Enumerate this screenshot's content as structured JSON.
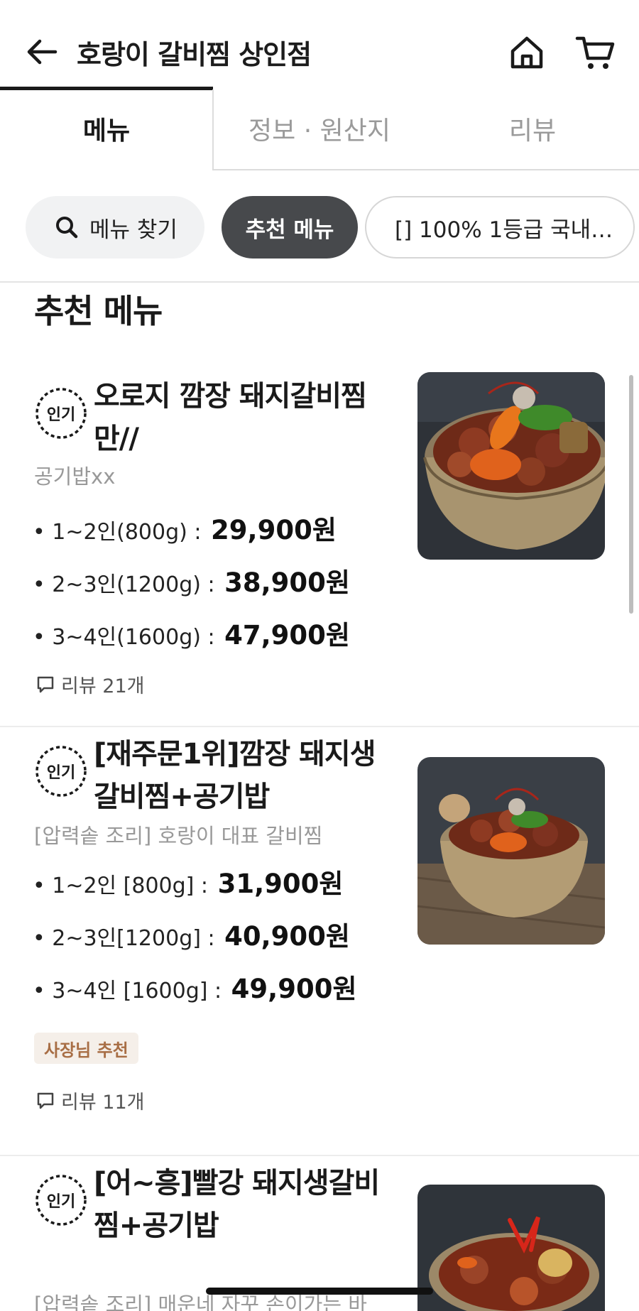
{
  "header": {
    "title": "호랑이 갈비찜 상인점",
    "icons": [
      "back-arrow-icon",
      "home-icon",
      "cart-icon"
    ]
  },
  "tabs": [
    {
      "label": "메뉴",
      "active": true
    },
    {
      "label": "정보 · 원산지",
      "active": false
    },
    {
      "label": "리뷰",
      "active": false
    }
  ],
  "chips": {
    "search": "메뉴 찾기",
    "recommend": "추천 메뉴",
    "origin": "[] 100% 1등급 국내…"
  },
  "section_title": "추천 메뉴",
  "items": [
    {
      "badge": "인기",
      "name_line1": "오로지 깜장 돼지갈비찜",
      "name_line2": "만//",
      "desc": "공기밥xx",
      "prices": [
        {
          "label": "• 1~2인(800g) :",
          "value": "29,900원"
        },
        {
          "label": "• 2~3인(1200g) :",
          "value": "38,900원"
        },
        {
          "label": "• 3~4인(1600g) :",
          "value": "47,900원"
        }
      ],
      "review": "리뷰 21개"
    },
    {
      "badge": "인기",
      "name_line1": "[재주문1위]깜장 돼지생",
      "name_line2": "갈비찜+공기밥",
      "desc": "[압력솥 조리]  호랑이 대표 갈비찜",
      "prices": [
        {
          "label": "• 1~2인 [800g] :",
          "value": "31,900원"
        },
        {
          "label": "• 2~3인[1200g] :",
          "value": "40,900원"
        },
        {
          "label": "• 3~4인 [1600g] :",
          "value": "49,900원"
        }
      ],
      "tag": "사장님 추천",
      "review": "리뷰 11개"
    },
    {
      "badge": "인기",
      "name_line1": "[어~흥]빨강 돼지생갈비",
      "name_line2": "찜+공기밥",
      "desc": "[압력솥 조리] 매운네 자꾸 손이가는 바"
    }
  ],
  "colors": {
    "active_chip": "#47494c",
    "owner_tag_bg": "#f5efe9",
    "owner_tag_text": "#a86e45",
    "muted_text": "#999999"
  }
}
